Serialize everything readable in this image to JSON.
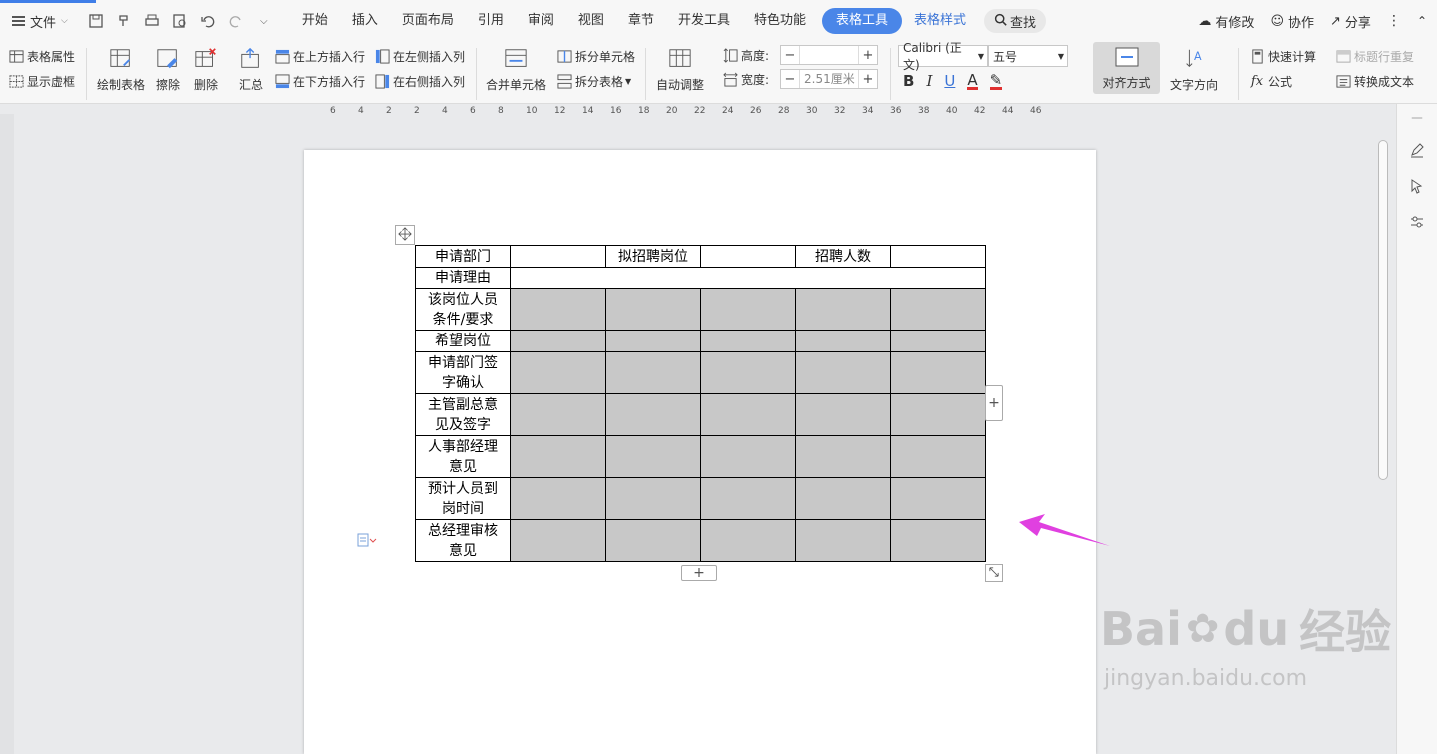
{
  "menubar": {
    "file_label": "文件",
    "tabs": [
      "开始",
      "插入",
      "页面布局",
      "引用",
      "审阅",
      "视图",
      "章节",
      "开发工具",
      "特色功能"
    ],
    "active_tab": "表格工具",
    "sub_tab": "表格样式",
    "search_label": "查找",
    "right_actions": {
      "modified": "有修改",
      "collab": "协作",
      "share": "分享"
    }
  },
  "ribbon": {
    "table_props": "表格属性",
    "show_grid": "显示虚框",
    "draw_table": "绘制表格",
    "erase": "擦除",
    "delete": "删除",
    "summary": "汇总",
    "insert_above": "在上方插入行",
    "insert_below": "在下方插入行",
    "insert_left": "在左侧插入列",
    "insert_right": "在右侧插入列",
    "merge_cells": "合并单元格",
    "split_cells": "拆分单元格",
    "split_table": "拆分表格",
    "auto_fit": "自动调整",
    "height_label": "高度:",
    "height_value": "",
    "width_label": "宽度:",
    "width_value": "2.51厘米",
    "font_name": "Calibri (正文)",
    "font_size": "五号",
    "align": "对齐方式",
    "text_direction": "文字方向",
    "quick_calc": "快速计算",
    "repeat_header": "标题行重复",
    "formula": "公式",
    "convert_text": "转换成文本"
  },
  "ruler": {
    "ticks": [
      "6",
      "4",
      "2",
      "2",
      "4",
      "6",
      "8",
      "10",
      "12",
      "14",
      "16",
      "18",
      "20",
      "22",
      "24",
      "26",
      "28",
      "30",
      "32",
      "34",
      "36",
      "38",
      "40",
      "42",
      "44",
      "46"
    ]
  },
  "table": {
    "row1": {
      "c0": "申请部门",
      "c2": "拟招聘岗位",
      "c4": "招聘人数"
    },
    "rows": [
      {
        "label": "申请理由"
      },
      {
        "label": "该岗位人员条件/要求",
        "line1": "该岗位人员",
        "line2": "条件/要求"
      },
      {
        "label": "希望岗位"
      },
      {
        "label": "申请部门签字确认",
        "line1": "申请部门签",
        "line2": "字确认"
      },
      {
        "label": "主管副总意见及签字",
        "line1": "主管副总意",
        "line2": "见及签字"
      },
      {
        "label": "人事部经理意见",
        "line1": "人事部经理",
        "line2": "意见"
      },
      {
        "label": "预计人员到岗时间",
        "line1": "预计人员到",
        "line2": "岗时间"
      },
      {
        "label": "总经理审核意见",
        "line1": "总经理审核",
        "line2": "意见"
      }
    ]
  },
  "watermark": {
    "brand": "Bai",
    "brand_du": "du",
    "brand_cn": "经验",
    "url": "jingyan.baidu.com"
  },
  "colors": {
    "accent": "#4a86e8",
    "cell_gray": "#c8c8c8",
    "arrow": "#e040e0"
  }
}
